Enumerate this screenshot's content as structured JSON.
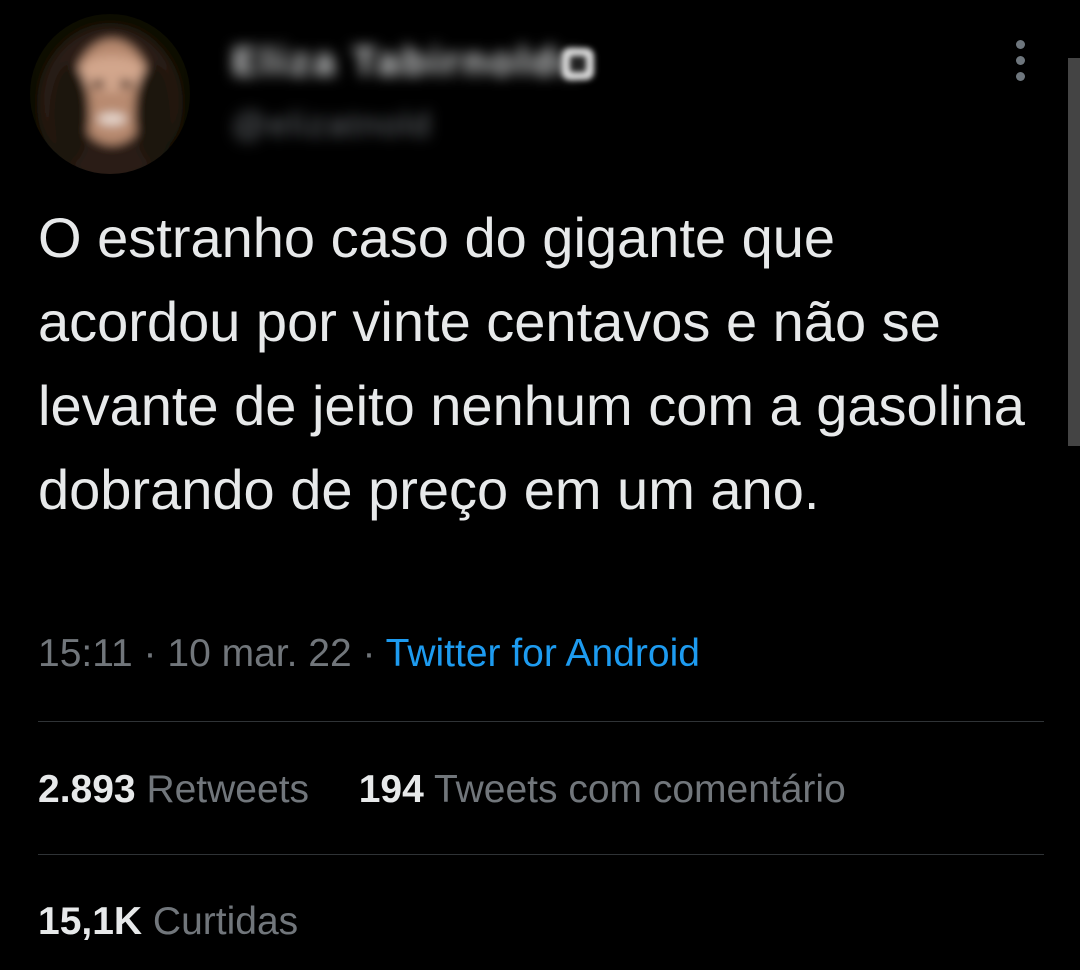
{
  "author": {
    "display_name": "Eliza Tabirnoldo",
    "handle": "@elizatnold"
  },
  "tweet": {
    "text": "O estranho caso do gigante que acordou por vinte centavos e não se levante de jeito nenhum com a gasolina dobrando de preço em um ano.",
    "time": "15:11",
    "separator": "·",
    "date": "10 mar. 22",
    "source": "Twitter for Android"
  },
  "stats": {
    "retweets_count": "2.893",
    "retweets_label": "Retweets",
    "quotes_count": "194",
    "quotes_label": "Tweets com comentário",
    "likes_count": "15,1K",
    "likes_label": "Curtidas"
  },
  "colors": {
    "background": "#000000",
    "text_primary": "#e7e9ea",
    "text_secondary": "#71767b",
    "link": "#1d9bf0",
    "divider": "#2f3336"
  },
  "icons": {
    "more": "more-vertical-icon",
    "verified": "verified-badge-icon"
  }
}
